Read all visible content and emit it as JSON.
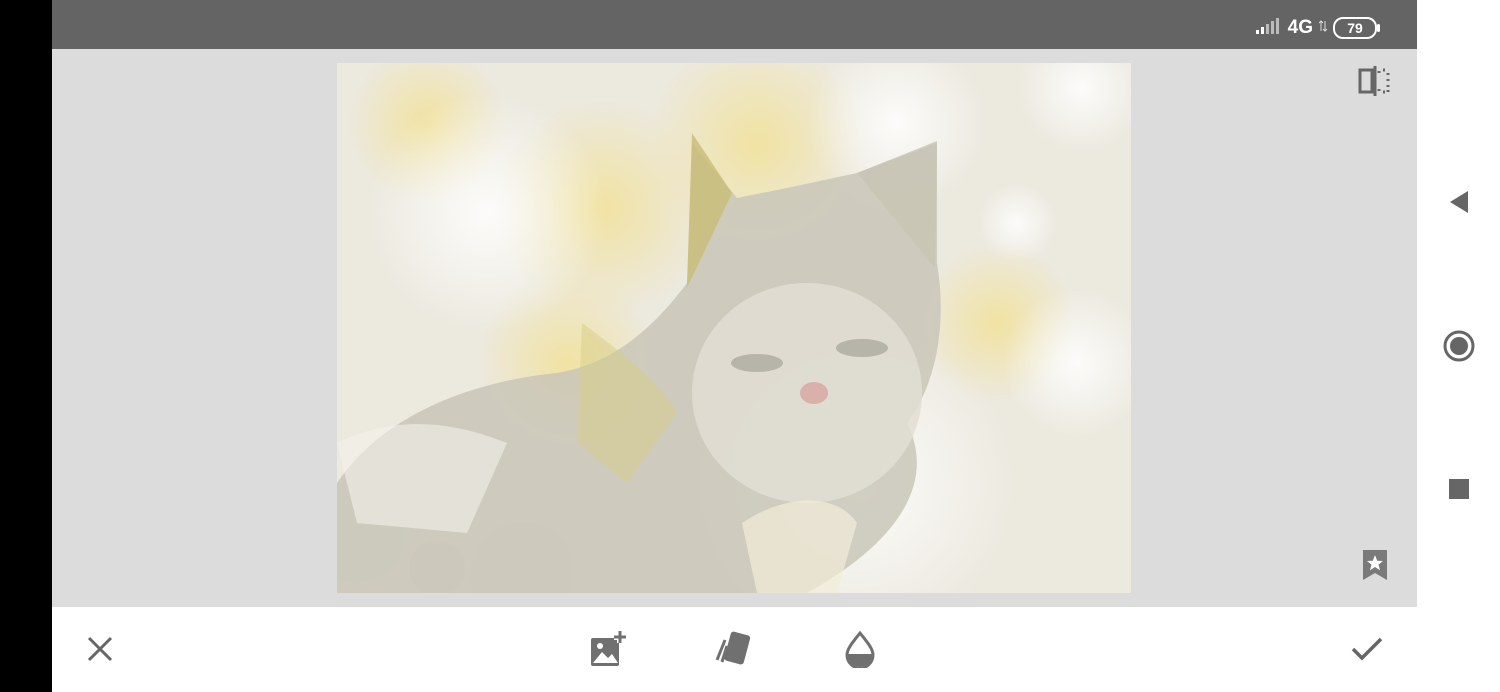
{
  "status_bar": {
    "network": "4G",
    "battery": "79",
    "icons": [
      "signal-icon",
      "data-arrows-icon",
      "battery-icon"
    ]
  },
  "editor": {
    "image_description_icon": "kitten-photo",
    "top_right_icon": "compare-icon",
    "bottom_right_icon": "bookmark-star-icon"
  },
  "toolbar": {
    "icons": [
      "close-icon",
      "add-image-icon",
      "card-styles-icon",
      "opacity-drop-icon",
      "checkmark-icon"
    ]
  },
  "nav": {
    "icons": [
      "back-triangle-icon",
      "home-circle-icon",
      "recents-square-icon"
    ]
  },
  "colors": {
    "status_bar": "#646464",
    "canvas": "#dcdcdc",
    "toolbar": "#ffffff",
    "icon": "#666666"
  }
}
